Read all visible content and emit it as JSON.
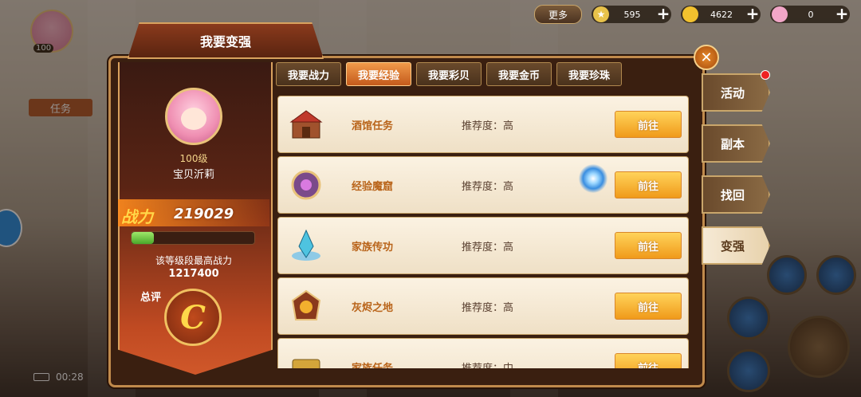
{
  "hud": {
    "more_label": "更多",
    "resources": [
      {
        "name": "energy",
        "value": "595",
        "icon": "star-badge-icon",
        "color": "#e8c24a"
      },
      {
        "name": "gold",
        "value": "4622",
        "icon": "gold-coin-icon",
        "color": "#f2c12e"
      },
      {
        "name": "pearl",
        "value": "0",
        "icon": "shell-pearl-icon",
        "color": "#f2a6c8"
      }
    ],
    "plus_symbol": "+"
  },
  "background": {
    "task_tab": "任务",
    "level_badge": "100",
    "clock": "00:28"
  },
  "dialog": {
    "title": "我要变强",
    "close_symbol": "✕",
    "hero": {
      "level": "100级",
      "name": "宝贝沂莉",
      "power_label": "战力",
      "power_value": "219029",
      "power_progress": 0.18,
      "max_label": "该等级段最高战力",
      "max_value": "1217400",
      "eval_label": "总评",
      "grade": "C"
    },
    "tabs": [
      {
        "label": "我要战力",
        "active": false
      },
      {
        "label": "我要经验",
        "active": true
      },
      {
        "label": "我要彩贝",
        "active": false
      },
      {
        "label": "我要金币",
        "active": false
      },
      {
        "label": "我要珍珠",
        "active": false
      }
    ],
    "rows": [
      {
        "name": "酒馆任务",
        "recommend": "推荐度：高",
        "button": "前往",
        "icon": "tavern-icon"
      },
      {
        "name": "经验魔窟",
        "recommend": "推荐度：高",
        "button": "前往",
        "icon": "magic-cave-icon"
      },
      {
        "name": "家族传功",
        "recommend": "推荐度：高",
        "button": "前往",
        "icon": "crystal-icon"
      },
      {
        "name": "灰烬之地",
        "recommend": "推荐度：高",
        "button": "前往",
        "icon": "ember-land-icon"
      },
      {
        "name": "家族任务",
        "recommend": "推荐度：中",
        "button": "前往",
        "icon": "family-task-icon"
      }
    ]
  },
  "side_tabs": [
    {
      "label": "活动",
      "active": false
    },
    {
      "label": "副本",
      "active": false
    },
    {
      "label": "找回",
      "active": false
    },
    {
      "label": "变强",
      "active": true
    }
  ]
}
